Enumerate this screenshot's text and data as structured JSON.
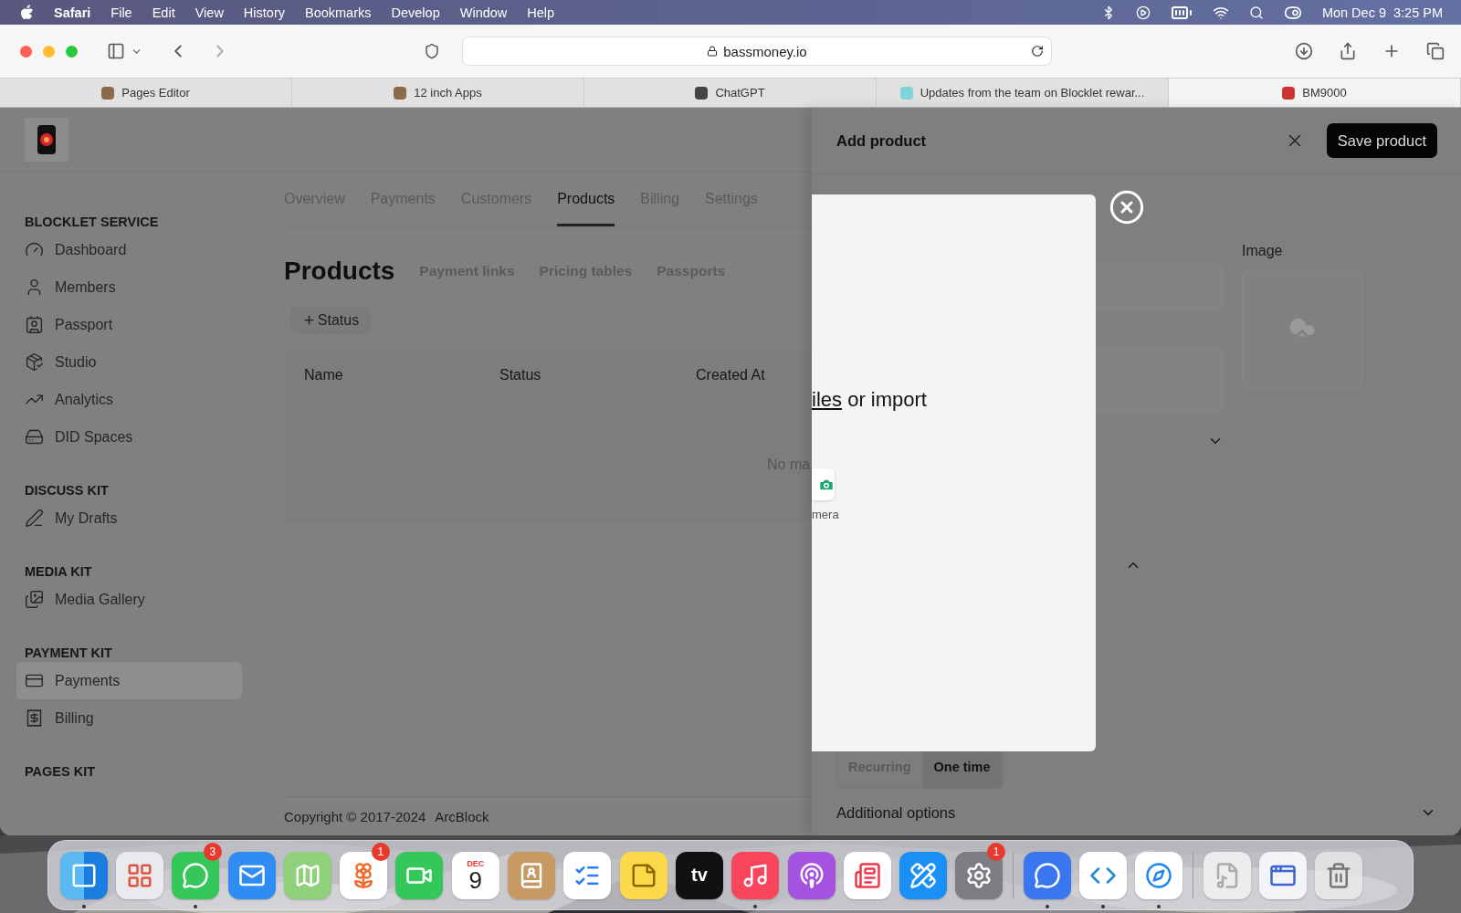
{
  "menubar": {
    "app": "Safari",
    "menus": [
      "File",
      "Edit",
      "View",
      "History",
      "Bookmarks",
      "Develop",
      "Window",
      "Help"
    ],
    "date": "Mon Dec 9",
    "time": "3:25 PM"
  },
  "browser": {
    "url": "bassmoney.io",
    "tabs": [
      {
        "title": "Pages Editor",
        "selected": false
      },
      {
        "title": "12 inch Apps",
        "selected": false
      },
      {
        "title": "ChatGPT",
        "selected": false
      },
      {
        "title": "Updates from the team on Blocklet rewar...",
        "selected": false
      },
      {
        "title": "BM9000",
        "selected": true
      }
    ]
  },
  "sidebar": {
    "sections": [
      {
        "heading": "BLOCKLET SERVICE",
        "items": [
          {
            "label": "Dashboard",
            "kind": "gauge",
            "selected": false
          },
          {
            "label": "Members",
            "kind": "user",
            "selected": false
          },
          {
            "label": "Passport",
            "kind": "badge",
            "selected": false
          },
          {
            "label": "Studio",
            "kind": "box",
            "selected": false
          },
          {
            "label": "Analytics",
            "kind": "trend",
            "selected": false
          },
          {
            "label": "DID Spaces",
            "kind": "drive",
            "selected": false
          }
        ]
      },
      {
        "heading": "DISCUSS KIT",
        "items": [
          {
            "label": "My Drafts",
            "kind": "pen",
            "selected": false
          }
        ]
      },
      {
        "heading": "MEDIA KIT",
        "items": [
          {
            "label": "Media Gallery",
            "kind": "images",
            "selected": false
          }
        ]
      },
      {
        "heading": "PAYMENT KIT",
        "items": [
          {
            "label": "Payments",
            "kind": "card",
            "selected": true
          },
          {
            "label": "Billing",
            "kind": "receipt",
            "selected": false
          }
        ]
      },
      {
        "heading": "PAGES KIT"
      }
    ]
  },
  "nav": {
    "tabs": [
      {
        "label": "Overview",
        "selected": false
      },
      {
        "label": "Payments",
        "selected": false
      },
      {
        "label": "Customers",
        "selected": false
      },
      {
        "label": "Products",
        "selected": true
      },
      {
        "label": "Billing",
        "selected": false
      },
      {
        "label": "Settings",
        "selected": false
      }
    ]
  },
  "page": {
    "title": "Products",
    "subtabs": [
      "Payment links",
      "Pricing tables",
      "Passports"
    ],
    "filter": "Status",
    "table": {
      "columns": [
        "Name",
        "Status",
        "Created At"
      ],
      "empty_text": "No ma"
    },
    "footer": {
      "copyright": "Copyright © 2017-2024",
      "company": "ArcBlock"
    }
  },
  "drawer": {
    "title": "Add product",
    "save": "Save product",
    "image_label": "Image",
    "price_type": [
      {
        "label": "Recurring",
        "selected": false
      },
      {
        "label": "One time",
        "selected": true
      }
    ],
    "additional": "Additional options"
  },
  "uploader": {
    "link": "iles",
    "text": "or import",
    "camera": "mera"
  },
  "dock": [
    {
      "kind": "finder",
      "running": true
    },
    {
      "kind": "launchpad",
      "running": false
    },
    {
      "kind": "messages",
      "badge": "3",
      "running": true
    },
    {
      "kind": "mail",
      "running": false
    },
    {
      "kind": "maps",
      "running": false
    },
    {
      "kind": "photos",
      "badge": "1",
      "running": false
    },
    {
      "kind": "facetime",
      "running": false
    },
    {
      "kind": "calendar",
      "month": "DEC",
      "day": "9",
      "running": false
    },
    {
      "kind": "contacts",
      "running": false
    },
    {
      "kind": "reminders",
      "running": false
    },
    {
      "kind": "notes",
      "running": false
    },
    {
      "kind": "tv",
      "label": "tv",
      "running": false
    },
    {
      "kind": "music",
      "running": true
    },
    {
      "kind": "podcasts",
      "running": false
    },
    {
      "kind": "news",
      "running": false
    },
    {
      "kind": "appstore",
      "running": false
    },
    {
      "kind": "settings",
      "badge": "1",
      "running": false
    },
    {
      "kind": "separator"
    },
    {
      "kind": "signal",
      "running": true
    },
    {
      "kind": "vscode",
      "running": true
    },
    {
      "kind": "safari",
      "running": true
    },
    {
      "kind": "separator"
    },
    {
      "kind": "document",
      "running": false
    },
    {
      "kind": "preview",
      "running": false
    },
    {
      "kind": "trash",
      "running": false
    }
  ]
}
